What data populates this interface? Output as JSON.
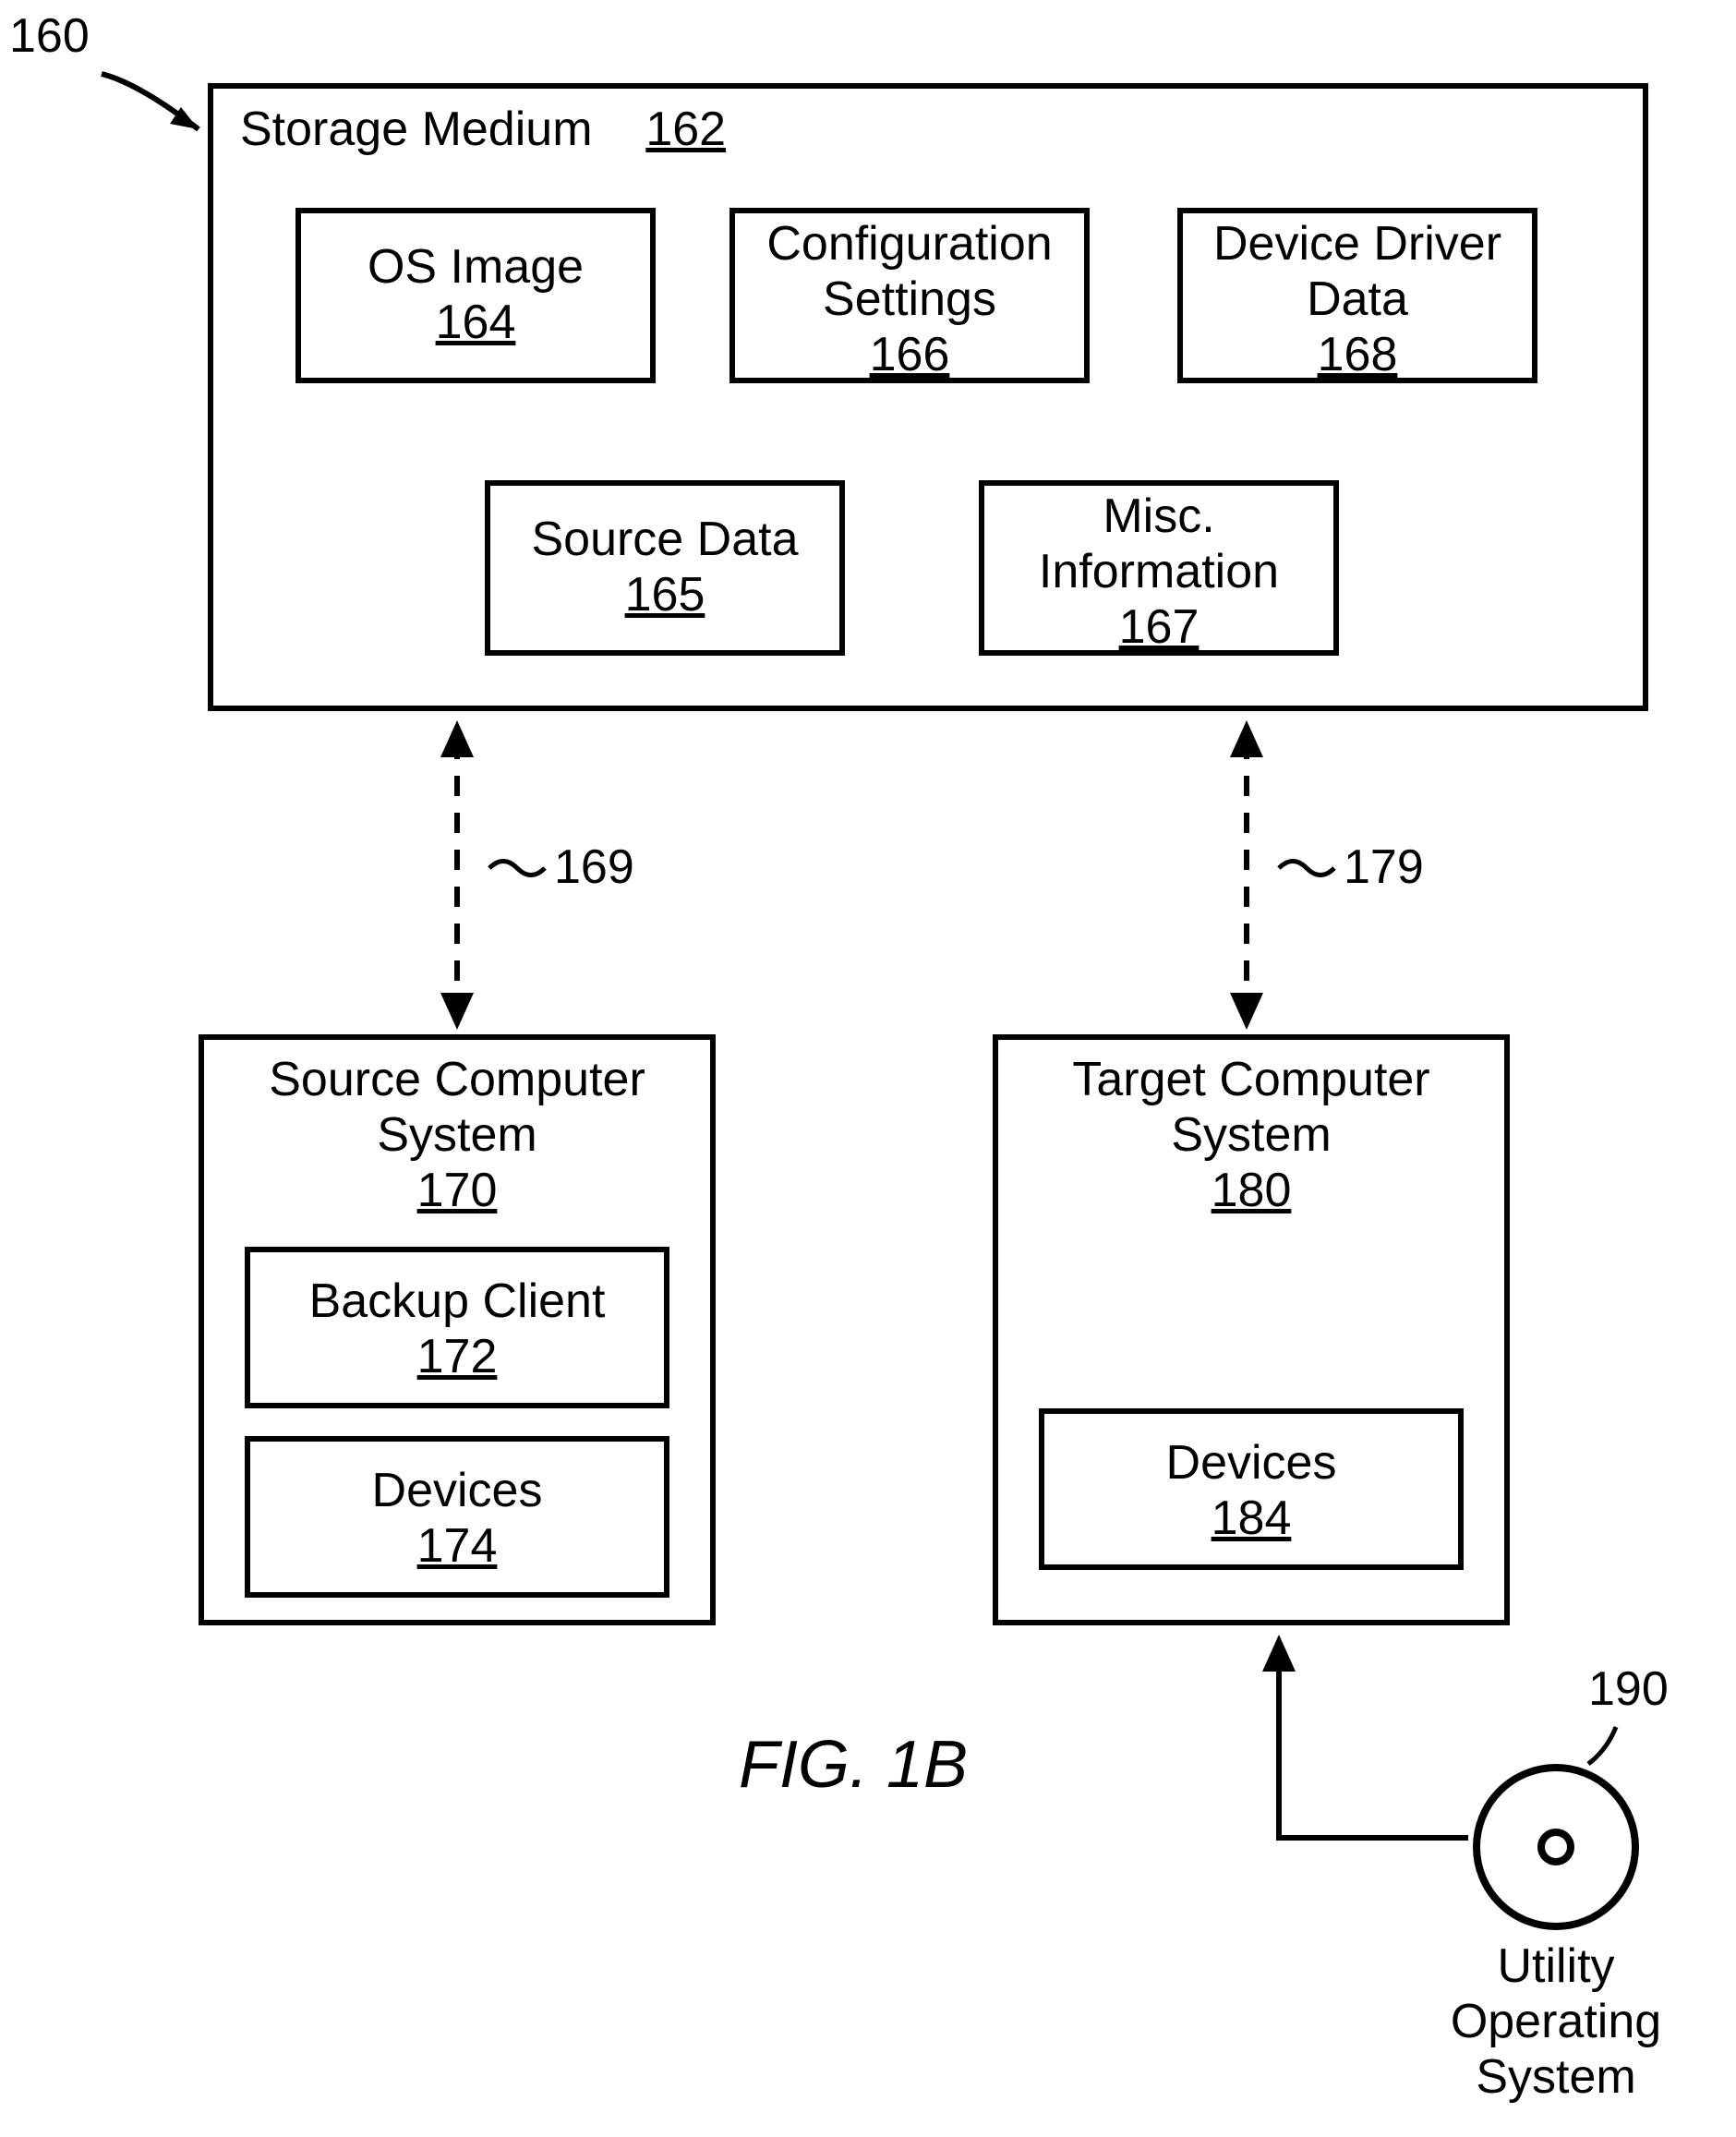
{
  "diagram_id": "160",
  "figure_label": "FIG. 1B",
  "storage_medium": {
    "title": "Storage Medium",
    "num": "162",
    "os_image": {
      "label": "OS Image",
      "num": "164"
    },
    "config": {
      "label": "Configuration Settings",
      "num": "166"
    },
    "driver": {
      "label": "Device Driver Data",
      "num": "168"
    },
    "source_data": {
      "label": "Source Data",
      "num": "165"
    },
    "misc": {
      "label": "Misc. Information",
      "num": "167"
    }
  },
  "link_left": "169",
  "link_right": "179",
  "source_system": {
    "title": "Source Computer System",
    "num": "170",
    "backup_client": {
      "label": "Backup Client",
      "num": "172"
    },
    "devices": {
      "label": "Devices",
      "num": "174"
    }
  },
  "target_system": {
    "title": "Target Computer System",
    "num": "180",
    "devices": {
      "label": "Devices",
      "num": "184"
    }
  },
  "utility_os": {
    "num": "190",
    "label": "Utility Operating System"
  }
}
